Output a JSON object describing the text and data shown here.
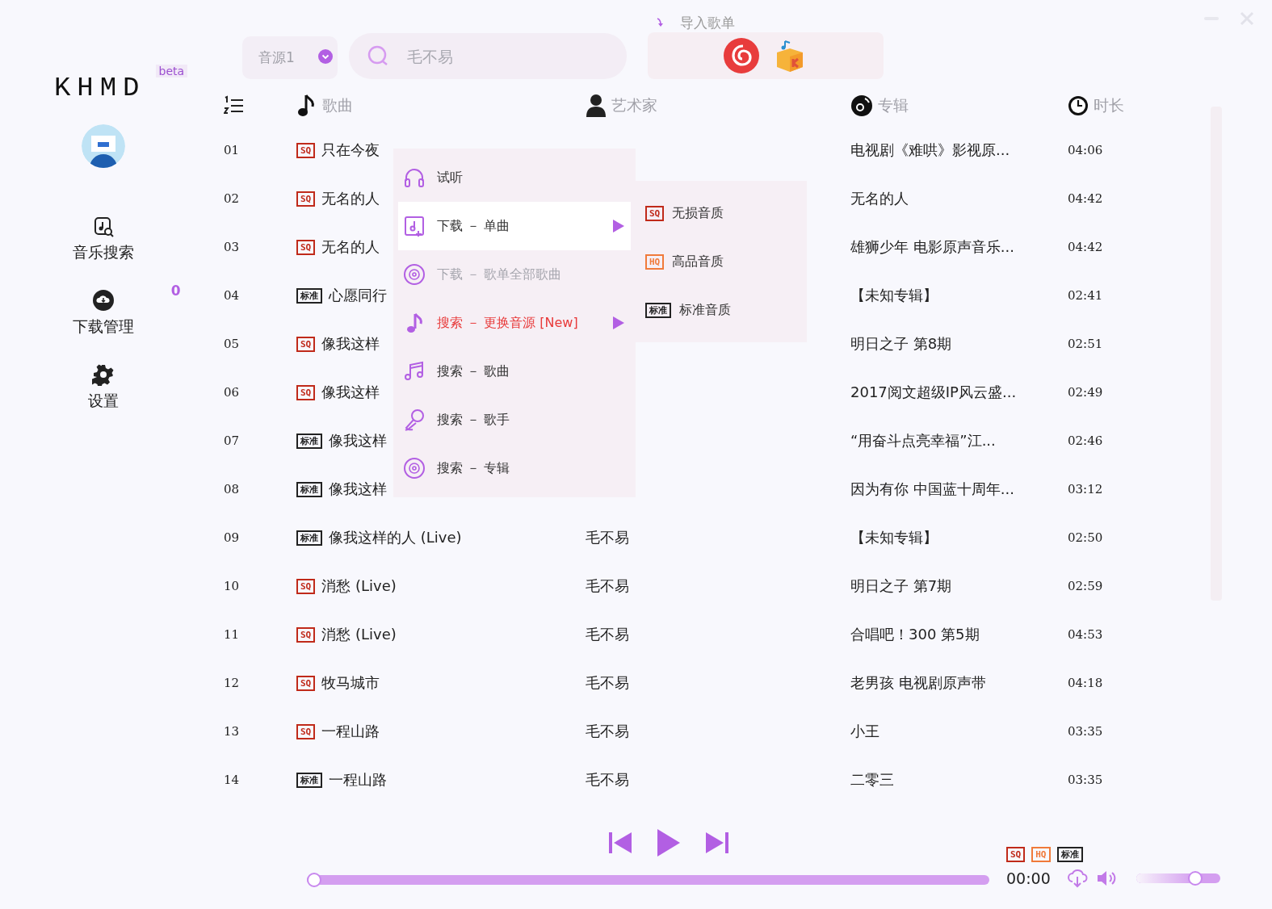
{
  "sidebar": {
    "logo": "KHMD",
    "badge": "beta",
    "items": [
      {
        "label": "音乐搜索",
        "selected": false
      },
      {
        "label": "下载管理",
        "selected": false,
        "count": "0"
      },
      {
        "label": "设置",
        "selected": false
      }
    ]
  },
  "toolbar": {
    "source": {
      "value": "音源1"
    },
    "search": {
      "placeholder": "毛不易"
    },
    "import": {
      "label": "导入歌单"
    }
  },
  "table": {
    "columns": [
      {},
      {
        "label": "歌曲"
      },
      {
        "label": "艺术家"
      },
      {
        "label": "专辑"
      },
      {
        "label": "时长"
      }
    ],
    "rows": [
      {
        "index": "01",
        "quality": {
          "kind": "sq",
          "label": "SQ"
        },
        "title": "只在今夜",
        "album": "电视剧《难哄》影视原...",
        "duration": "04:06"
      },
      {
        "index": "02",
        "quality": {
          "kind": "sq",
          "label": "SQ"
        },
        "title": "无名的人",
        "album": "无名的人",
        "duration": "04:42"
      },
      {
        "index": "03",
        "quality": {
          "kind": "sq",
          "label": "SQ"
        },
        "title": "无名的人",
        "album": "雄狮少年 电影原声音乐...",
        "duration": "04:42"
      },
      {
        "index": "04",
        "quality": {
          "kind": "std",
          "label": "标准"
        },
        "title": "心愿同行",
        "album": "【未知专辑】",
        "duration": "02:41"
      },
      {
        "index": "05",
        "quality": {
          "kind": "sq",
          "label": "SQ"
        },
        "title": "像我这样",
        "album": "明日之子 第8期",
        "duration": "02:51"
      },
      {
        "index": "06",
        "quality": {
          "kind": "sq",
          "label": "SQ"
        },
        "title": "像我这样",
        "album": "2017阅文超级IP风云盛...",
        "duration": "02:49"
      },
      {
        "index": "07",
        "quality": {
          "kind": "std",
          "label": "标准"
        },
        "title": "像我这样",
        "album": "“用奋斗点亮幸福”江...",
        "duration": "02:46"
      },
      {
        "index": "08",
        "quality": {
          "kind": "std",
          "label": "标准"
        },
        "title": "像我这样",
        "album": "因为有你 中国蓝十周年...",
        "duration": "03:12"
      },
      {
        "index": "09",
        "quality": {
          "kind": "std",
          "label": "标准"
        },
        "title": "像我这样的人 (Live)",
        "artist": "毛不易",
        "album": "【未知专辑】",
        "duration": "02:50"
      },
      {
        "index": "10",
        "quality": {
          "kind": "sq",
          "label": "SQ"
        },
        "title": "消愁 (Live)",
        "artist": "毛不易",
        "album": "明日之子 第7期",
        "duration": "02:59"
      },
      {
        "index": "11",
        "quality": {
          "kind": "sq",
          "label": "SQ"
        },
        "title": "消愁 (Live)",
        "artist": "毛不易",
        "album": "合唱吧！300 第5期",
        "duration": "04:53"
      },
      {
        "index": "12",
        "quality": {
          "kind": "sq",
          "label": "SQ"
        },
        "title": "牧马城市",
        "artist": "毛不易",
        "album": "老男孩 电视剧原声带",
        "duration": "04:18"
      },
      {
        "index": "13",
        "quality": {
          "kind": "sq",
          "label": "SQ"
        },
        "title": "一程山路",
        "artist": "毛不易",
        "album": "小王",
        "duration": "03:35"
      },
      {
        "index": "14",
        "quality": {
          "kind": "std",
          "label": "标准"
        },
        "title": "一程山路",
        "artist": "毛不易",
        "album": "二零三",
        "duration": "03:35"
      }
    ]
  },
  "context_menu": {
    "items": [
      {
        "label": "试听",
        "selected": false,
        "disabled": false,
        "accent": false,
        "submenu": false
      },
      {
        "label": "下载 － 单曲",
        "selected": true,
        "disabled": false,
        "accent": false,
        "submenu": true
      },
      {
        "label": "下载 － 歌单全部歌曲",
        "selected": false,
        "disabled": true,
        "accent": false,
        "submenu": false
      },
      {
        "label": "搜索 － 更换音源 [New]",
        "selected": false,
        "disabled": false,
        "accent": true,
        "submenu": true
      },
      {
        "label": "搜索 － 歌曲",
        "selected": false,
        "disabled": false,
        "accent": false,
        "submenu": false
      },
      {
        "label": "搜索 － 歌手",
        "selected": false,
        "disabled": false,
        "accent": false,
        "submenu": false
      },
      {
        "label": "搜索 － 专辑",
        "selected": false,
        "disabled": false,
        "accent": false,
        "submenu": false
      }
    ]
  },
  "submenu": {
    "items": [
      {
        "quality": {
          "kind": "sq",
          "label": "SQ"
        },
        "label": "无损音质"
      },
      {
        "quality": {
          "kind": "hq",
          "label": "HQ"
        },
        "label": "高品音质"
      },
      {
        "quality": {
          "kind": "std",
          "label": "标准"
        },
        "label": "标准音质"
      }
    ]
  },
  "player": {
    "progress": {
      "level": 0
    },
    "time": "00:00",
    "qualities": [
      {
        "kind": "sq",
        "label": "SQ"
      },
      {
        "kind": "hq",
        "label": "HQ"
      },
      {
        "kind": "std",
        "label": "标准"
      }
    ],
    "volume": {
      "level": 0.7
    }
  }
}
